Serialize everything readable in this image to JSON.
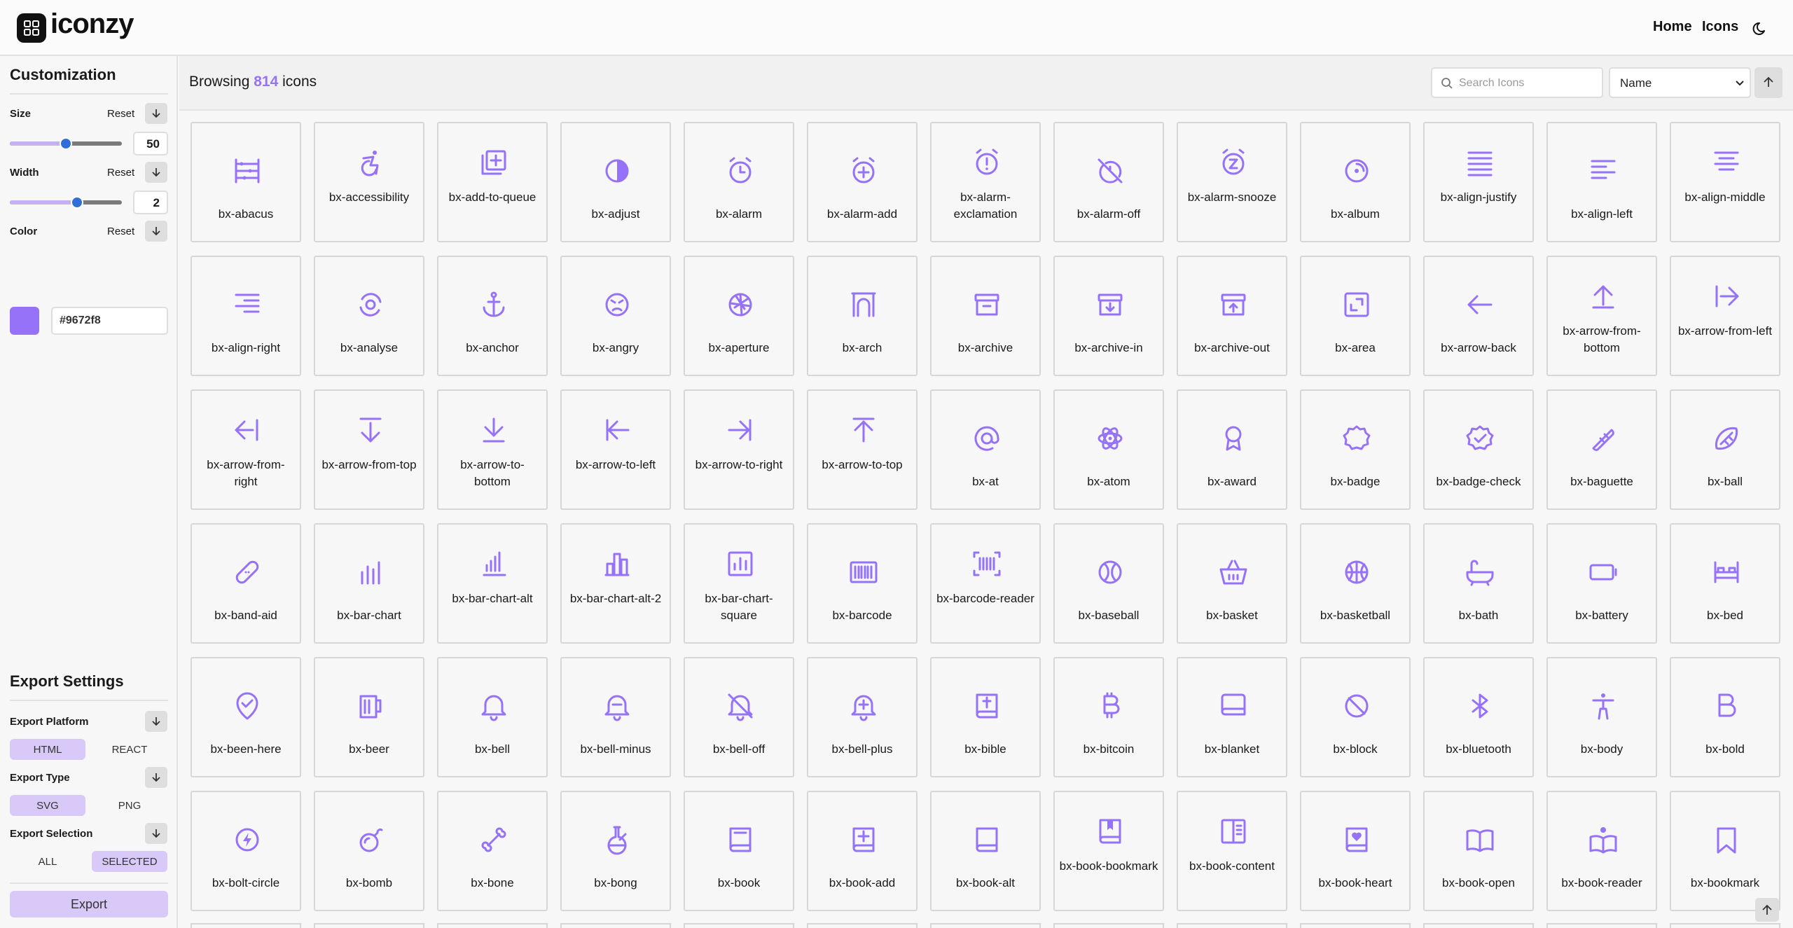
{
  "app": {
    "name": "iconzy",
    "nav": [
      "Home",
      "Icons"
    ]
  },
  "theme": {
    "accent": "#9672f8",
    "accent_light": "#d8c9f8"
  },
  "sidebar": {
    "customization_title": "Customization",
    "size": {
      "label": "Size",
      "reset": "Reset",
      "value": "50",
      "level": 0.5
    },
    "width": {
      "label": "Width",
      "reset": "Reset",
      "value": "2",
      "level": 0.6
    },
    "color": {
      "label": "Color",
      "reset": "Reset",
      "value": "#9672f8"
    },
    "export_title": "Export Settings",
    "export_platform": {
      "label": "Export Platform",
      "options": [
        "HTML",
        "REACT"
      ],
      "selected": "HTML"
    },
    "export_type": {
      "label": "Export Type",
      "options": [
        "SVG",
        "PNG"
      ],
      "selected": "SVG"
    },
    "export_selection": {
      "label": "Export Selection",
      "options": [
        "ALL",
        "SELECTED"
      ],
      "selected": "SELECTED"
    },
    "export_button": "Export"
  },
  "header": {
    "browsing_prefix": "Browsing",
    "icon_count": "814",
    "browsing_suffix": "icons",
    "search_placeholder": "Search Icons",
    "sort_value": "Name"
  },
  "icons": [
    "bx-abacus",
    "bx-accessibility",
    "bx-add-to-queue",
    "bx-adjust",
    "bx-alarm",
    "bx-alarm-add",
    "bx-alarm-exclamation",
    "bx-alarm-off",
    "bx-alarm-snooze",
    "bx-album",
    "bx-align-justify",
    "bx-align-left",
    "bx-align-middle",
    "bx-align-right",
    "bx-analyse",
    "bx-anchor",
    "bx-angry",
    "bx-aperture",
    "bx-arch",
    "bx-archive",
    "bx-archive-in",
    "bx-archive-out",
    "bx-area",
    "bx-arrow-back",
    "bx-arrow-from-bottom",
    "bx-arrow-from-left",
    "bx-arrow-from-right",
    "bx-arrow-from-top",
    "bx-arrow-to-bottom",
    "bx-arrow-to-left",
    "bx-arrow-to-right",
    "bx-arrow-to-top",
    "bx-at",
    "bx-atom",
    "bx-award",
    "bx-badge",
    "bx-badge-check",
    "bx-baguette",
    "bx-ball",
    "bx-band-aid",
    "bx-bar-chart",
    "bx-bar-chart-alt",
    "bx-bar-chart-alt-2",
    "bx-bar-chart-square",
    "bx-barcode",
    "bx-barcode-reader",
    "bx-baseball",
    "bx-basket",
    "bx-basketball",
    "bx-bath",
    "bx-battery",
    "bx-bed",
    "bx-been-here",
    "bx-beer",
    "bx-bell",
    "bx-bell-minus",
    "bx-bell-off",
    "bx-bell-plus",
    "bx-bible",
    "bx-bitcoin",
    "bx-blanket",
    "bx-block",
    "bx-bluetooth",
    "bx-body",
    "bx-bold",
    "bx-bolt-circle",
    "bx-bomb",
    "bx-bone",
    "bx-bong",
    "bx-book",
    "bx-book-add",
    "bx-book-alt",
    "bx-book-bookmark",
    "bx-book-content",
    "bx-book-heart",
    "bx-book-open",
    "bx-book-reader",
    "bx-bookmark"
  ]
}
